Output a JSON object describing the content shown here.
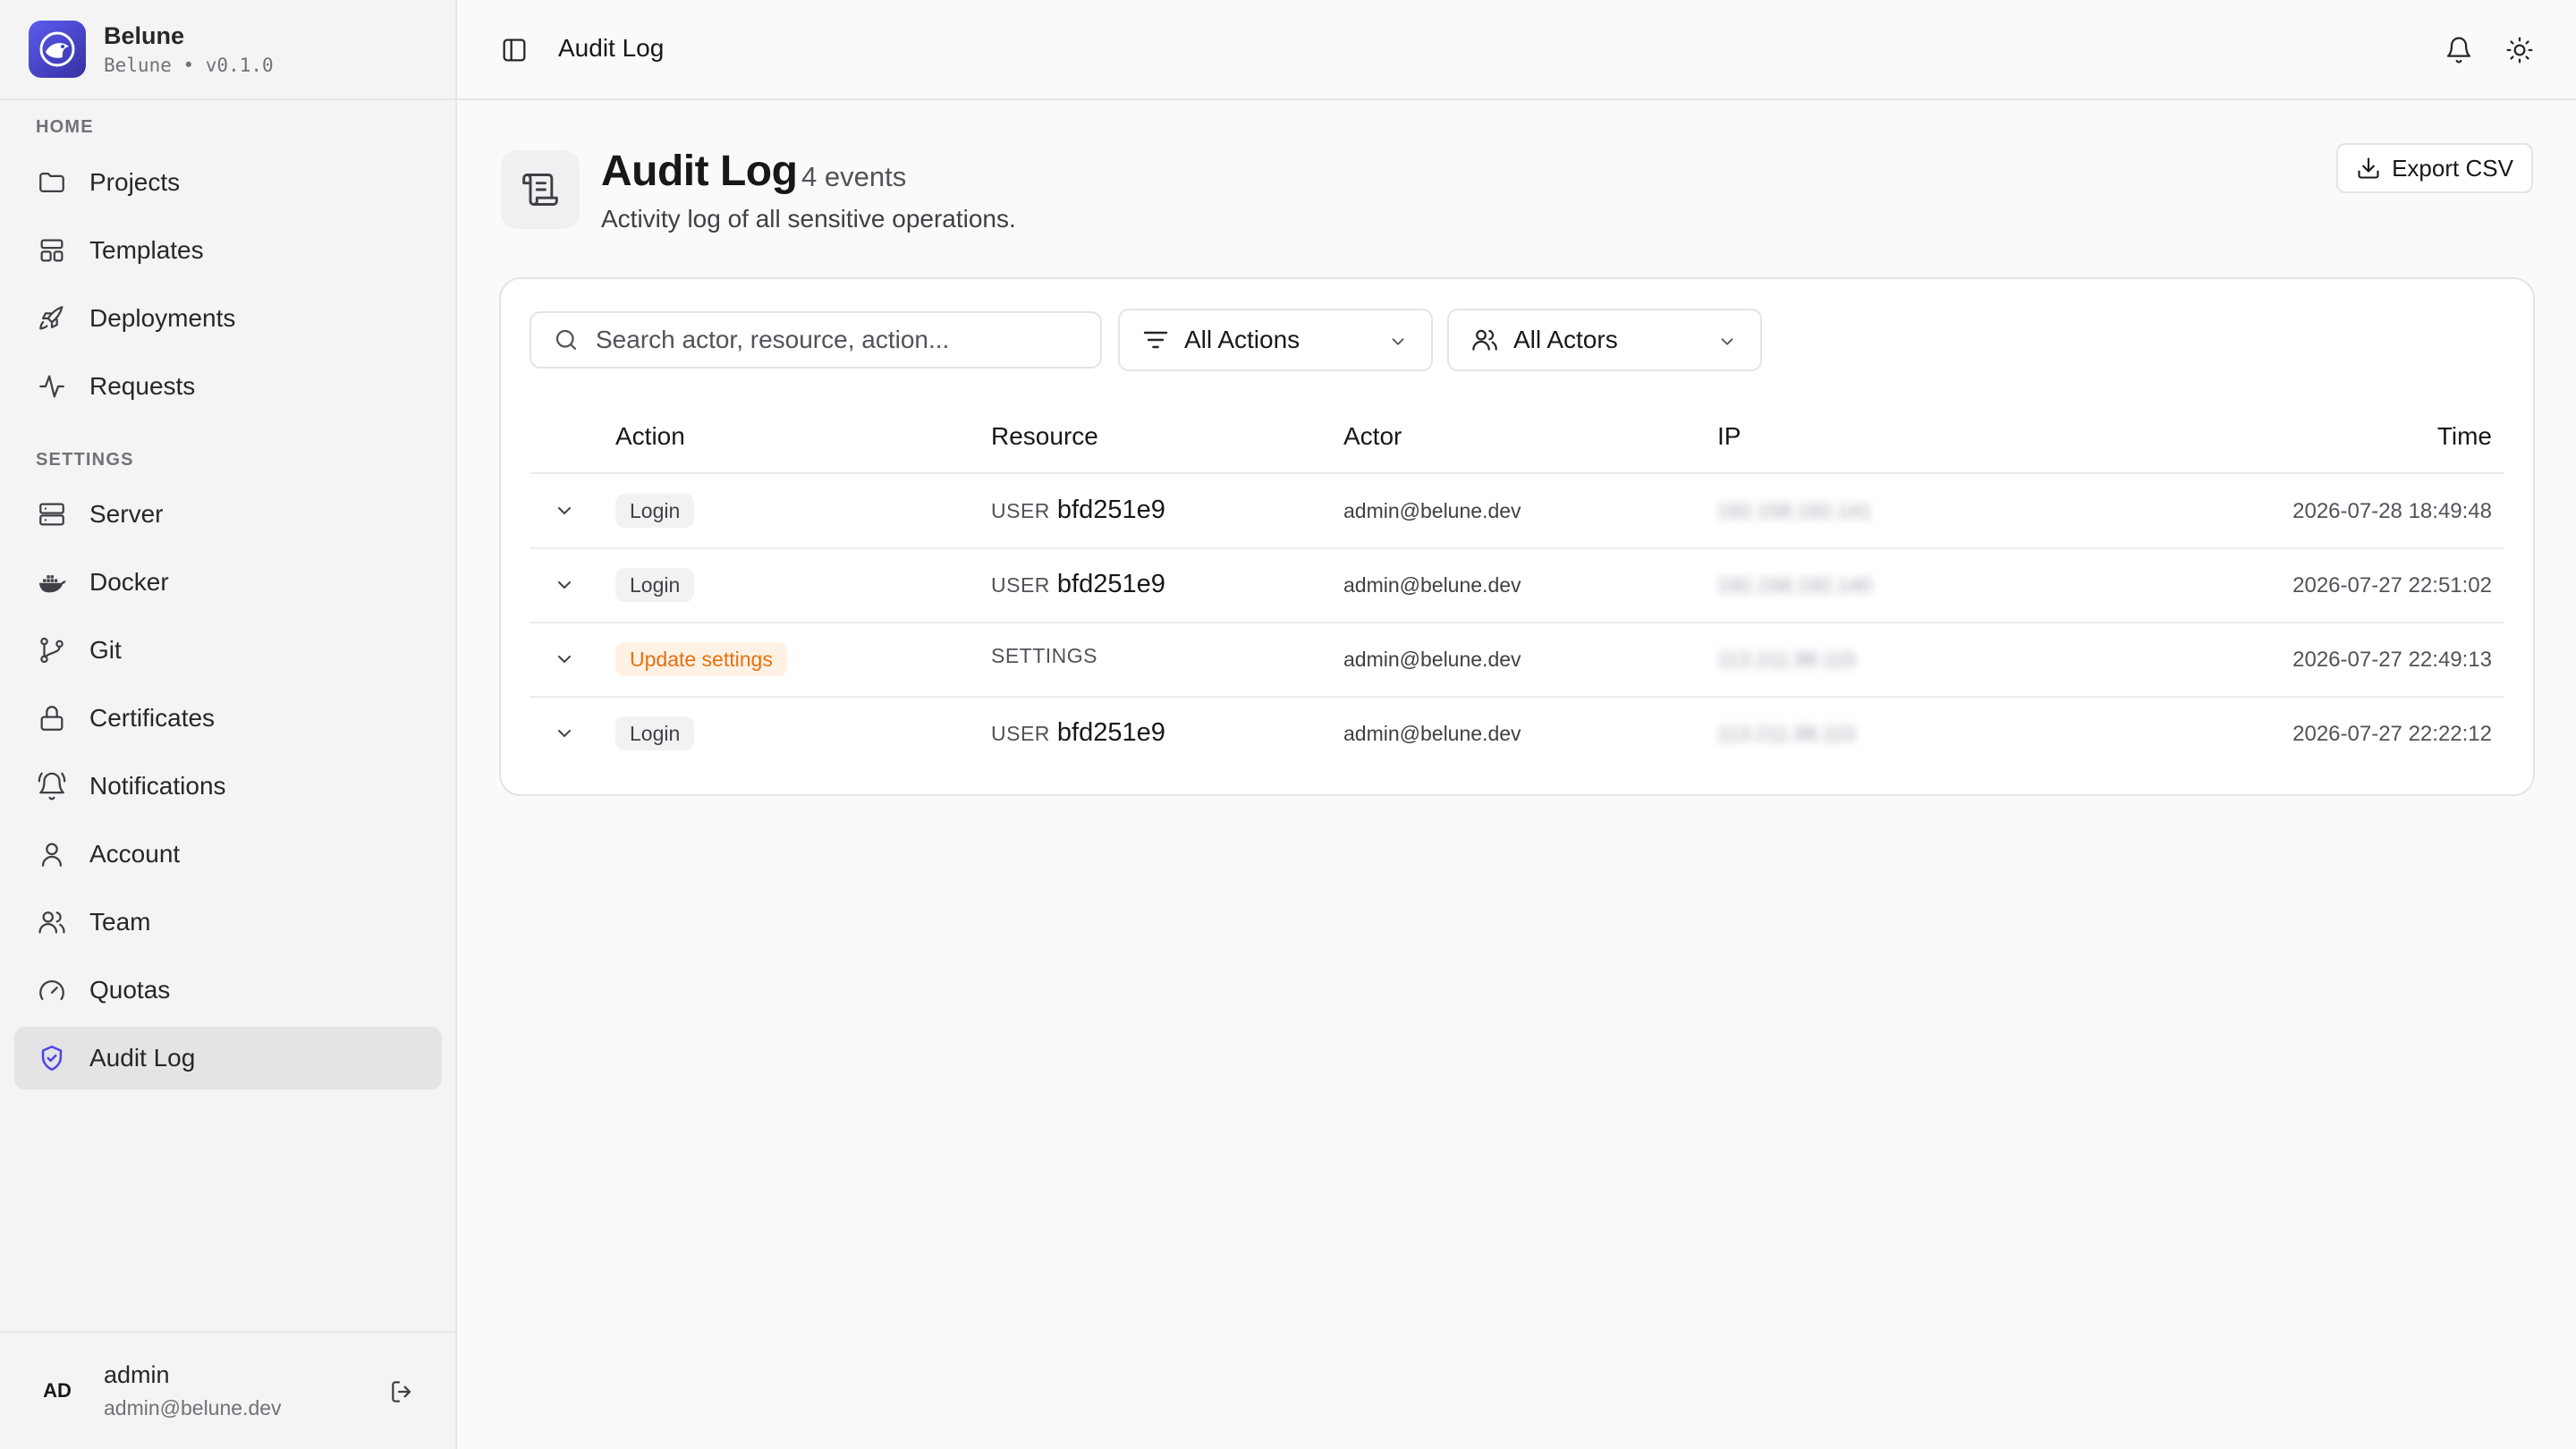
{
  "brand": {
    "name": "Belune",
    "subtitle": "Belune • v0.1.0"
  },
  "sidebar": {
    "sections": [
      {
        "label": "HOME",
        "items": [
          {
            "label": "Projects",
            "icon": "folder-icon"
          },
          {
            "label": "Templates",
            "icon": "templates-icon"
          },
          {
            "label": "Deployments",
            "icon": "rocket-icon"
          },
          {
            "label": "Requests",
            "icon": "activity-icon"
          }
        ]
      },
      {
        "label": "SETTINGS",
        "items": [
          {
            "label": "Server",
            "icon": "server-icon"
          },
          {
            "label": "Docker",
            "icon": "docker-icon"
          },
          {
            "label": "Git",
            "icon": "git-branch-icon"
          },
          {
            "label": "Certificates",
            "icon": "lock-icon"
          },
          {
            "label": "Notifications",
            "icon": "bell-ring-icon"
          },
          {
            "label": "Account",
            "icon": "user-icon"
          },
          {
            "label": "Team",
            "icon": "users-icon"
          },
          {
            "label": "Quotas",
            "icon": "gauge-icon"
          },
          {
            "label": "Audit Log",
            "icon": "shield-check-icon",
            "active": true
          }
        ]
      }
    ]
  },
  "user": {
    "initials": "AD",
    "name": "admin",
    "email": "admin@belune.dev"
  },
  "topbar": {
    "title": "Audit Log"
  },
  "page": {
    "title": "Audit Log",
    "count": "4 events",
    "description": "Activity log of all sensitive operations.",
    "export_label": "Export CSV"
  },
  "filters": {
    "search_placeholder": "Search actor, resource, action...",
    "actions_label": "All Actions",
    "actors_label": "All Actors"
  },
  "table": {
    "headers": {
      "action": "Action",
      "resource": "Resource",
      "actor": "Actor",
      "ip": "IP",
      "time": "Time"
    },
    "rows": [
      {
        "action": "Login",
        "variant": "default",
        "resource_type": "USER",
        "resource_id": "bfd251e9",
        "actor": "admin@belune.dev",
        "ip": "192.158.192.141",
        "time": "2026-07-28 18:49:48"
      },
      {
        "action": "Login",
        "variant": "default",
        "resource_type": "USER",
        "resource_id": "bfd251e9",
        "actor": "admin@belune.dev",
        "ip": "192.158.192.140",
        "time": "2026-07-27 22:51:02"
      },
      {
        "action": "Update settings",
        "variant": "warning",
        "resource_type": "SETTINGS",
        "resource_id": "",
        "actor": "admin@belune.dev",
        "ip": "113.211.98.115",
        "time": "2026-07-27 22:49:13"
      },
      {
        "action": "Login",
        "variant": "default",
        "resource_type": "USER",
        "resource_id": "bfd251e9",
        "actor": "admin@belune.dev",
        "ip": "113.211.98.115",
        "time": "2026-07-27 22:22:12"
      }
    ]
  },
  "colors": {
    "accent": "#4f46e5",
    "warning": "#e8700f",
    "warning_bg": "#fff1e4"
  }
}
